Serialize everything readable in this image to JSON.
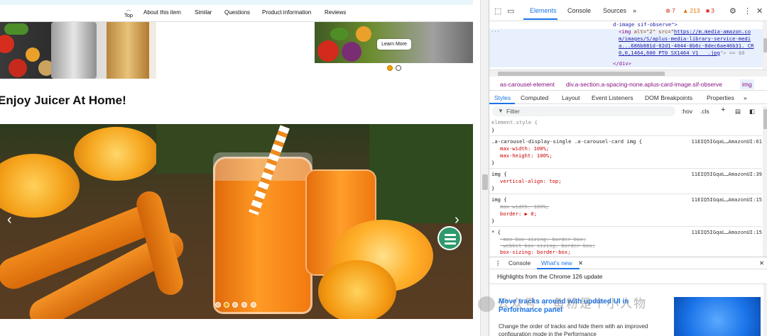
{
  "nav": {
    "items": [
      "Top",
      "About this item",
      "Similar",
      "Questions",
      "Product information",
      "Reviews"
    ]
  },
  "banner": {
    "learn_more": "Learn More"
  },
  "section": {
    "heading": "Enjoy Juicer At Home!"
  },
  "hero": {
    "prev_arrow": "‹",
    "next_arrow": "›"
  },
  "devtools": {
    "tabs": [
      "Elements",
      "Console",
      "Sources",
      "»"
    ],
    "errors": "7",
    "warnings": "213",
    "issues": "3",
    "dom": {
      "line1": "d-image sif-observe\">",
      "line2_tag": "<img",
      "line2_attr1": "alt=\"2\"",
      "line2_attr2": "src=\"",
      "line2_url1": "https://m.media-amazon.co",
      "line3_url": "m/images/S/aplus-media-library-service-medi",
      "line4_url": "a...686b881d-02d1-4044-8b6c-8dec6ae46b31._CR",
      "line5_url": "0,0,1464,600_PT0_SX1464_V1___.jpg",
      "line5_tail": "\"> == $0",
      "line6": "</div>"
    },
    "breadcrumbs": [
      "as-carousel-element",
      "div.a-section.a-spacing-none.aplus-card-image.sif-observe",
      "img"
    ],
    "subtabs": [
      "Styles",
      "Computed",
      "Layout",
      "Event Listeners",
      "DOM Breakpoints",
      "Properties",
      "»"
    ],
    "filter": {
      "placeholder": "Filter",
      "hov": ":hov",
      "cls": ".cls",
      "plus": "+"
    },
    "rules": [
      {
        "selector": "element.style {",
        "source": "",
        "lines": [
          "}"
        ]
      },
      {
        "selector": ".a-carousel-display-single .a-carousel-card img {",
        "source": "11EIQ5IGqaL…AmazonUI:61",
        "lines": [
          "max-width: 100%;",
          "max-height: 100%;",
          "}"
        ]
      },
      {
        "selector": "img {",
        "source": "11EIQ5IGqaL…AmazonUI:39",
        "lines": [
          "vertical-align: top;",
          "}"
        ]
      },
      {
        "selector": "img {",
        "source": "11EIQ5IGqaL…AmazonUI:15",
        "lines": [
          "max-width: 100%;",
          "border: ▶ 0;",
          "}"
        ]
      },
      {
        "selector": "* {",
        "source": "11EIQ5IGqaL…AmazonUI:15",
        "lines": [
          "-moz-box-sizing: border-box;",
          "-webkit-box-sizing: border-box;",
          "box-sizing: border-box;"
        ]
      }
    ],
    "drawer_tabs": [
      "Console",
      "What's new"
    ],
    "whats_new": {
      "header": "Highlights from the Chrome 126 update",
      "title": "Move tracks around with updated UI in Performance panel",
      "body": "Change the order of tracks and hide them with an improved configuration mode in the Performance"
    }
  },
  "watermark": "公众号 · 鱼粉是个小人物",
  "colors": {
    "accent": "#1a73e8",
    "carousel_dot_active": "#f0a000",
    "menu_button": "#2e9a6c"
  }
}
